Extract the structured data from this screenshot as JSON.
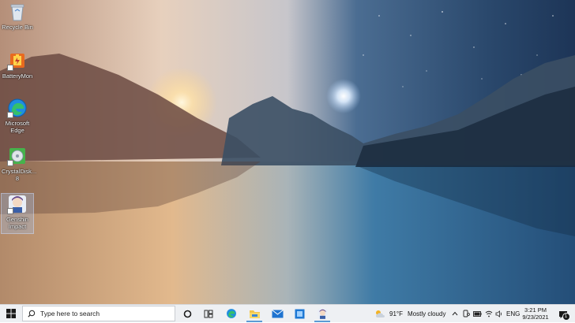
{
  "desktop_icons": [
    {
      "label": "Recycle Bin",
      "icon": "recycle-bin-icon"
    },
    {
      "label": "BatteryMon",
      "icon": "batterymon-icon"
    },
    {
      "label": "Microsoft Edge",
      "icon": "edge-icon"
    },
    {
      "label": "CrystalDisk... 8",
      "icon": "crystaldisk-icon"
    },
    {
      "label": "Genshin Impact",
      "icon": "genshin-icon"
    }
  ],
  "taskbar": {
    "search_placeholder": "Type here to search",
    "weather_temp": "91°F",
    "weather_desc": "Mostly cloudy",
    "language": "ENG",
    "time": "3:21 PM",
    "date": "9/23/2021",
    "notification_count": "1",
    "accent": "#5b9bd5",
    "pinned": [
      "edge-icon",
      "file-explorer-icon",
      "mail-icon",
      "app-icon",
      "genshin-icon"
    ]
  }
}
